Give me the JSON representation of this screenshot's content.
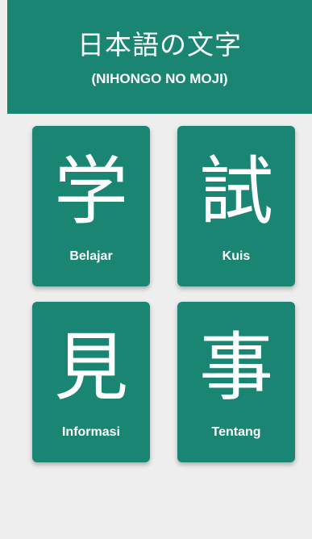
{
  "header": {
    "title": "日本語の文字",
    "subtitle": "(NIHONGO NO MOJI)"
  },
  "menu": {
    "items": [
      {
        "kanji": "学",
        "label": "Belajar"
      },
      {
        "kanji": "試",
        "label": "Kuis"
      },
      {
        "kanji": "見",
        "label": "Informasi"
      },
      {
        "kanji": "事",
        "label": "Tentang"
      }
    ]
  },
  "colors": {
    "primary": "#1a8572",
    "background": "#eeeeee",
    "text": "#ffffff"
  }
}
